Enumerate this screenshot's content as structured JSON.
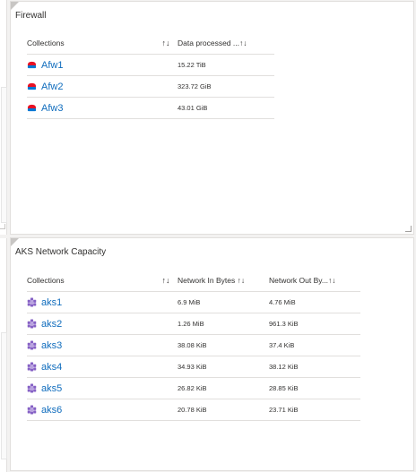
{
  "firewall": {
    "title": "Firewall",
    "headers": {
      "collections": "Collections",
      "sort": "↑↓",
      "data_processed": "Data processed ...↑↓"
    },
    "rows": [
      {
        "name": "Afw1",
        "data_processed": "15.22 TiB"
      },
      {
        "name": "Afw2",
        "data_processed": "323.72 GiB"
      },
      {
        "name": "Afw3",
        "data_processed": "43.01 GiB"
      }
    ],
    "icon": "firewall-icon"
  },
  "aks": {
    "title": "AKS Network Capacity",
    "headers": {
      "collections": "Collections",
      "sort": "↑↓",
      "network_in": "Network In Bytes ↑↓",
      "network_out": "Network Out By...↑↓"
    },
    "rows": [
      {
        "name": "aks1",
        "in": "6.9 MiB",
        "out": "4.76 MiB"
      },
      {
        "name": "aks2",
        "in": "1.26 MiB",
        "out": "961.3 KiB"
      },
      {
        "name": "aks3",
        "in": "38.08 KiB",
        "out": "37.4 KiB"
      },
      {
        "name": "aks4",
        "in": "34.93 KiB",
        "out": "38.12 KiB"
      },
      {
        "name": "aks5",
        "in": "26.82 KiB",
        "out": "28.85 KiB"
      },
      {
        "name": "aks6",
        "in": "20.78 KiB",
        "out": "23.71 KiB"
      }
    ],
    "icon": "kubernetes-cluster-icon"
  },
  "colors": {
    "link": "#0f6cbd",
    "border": "#e1dfdd",
    "aks_purple": "#8661c5",
    "firewall_red": "#e81123",
    "firewall_blue": "#0078d4"
  }
}
